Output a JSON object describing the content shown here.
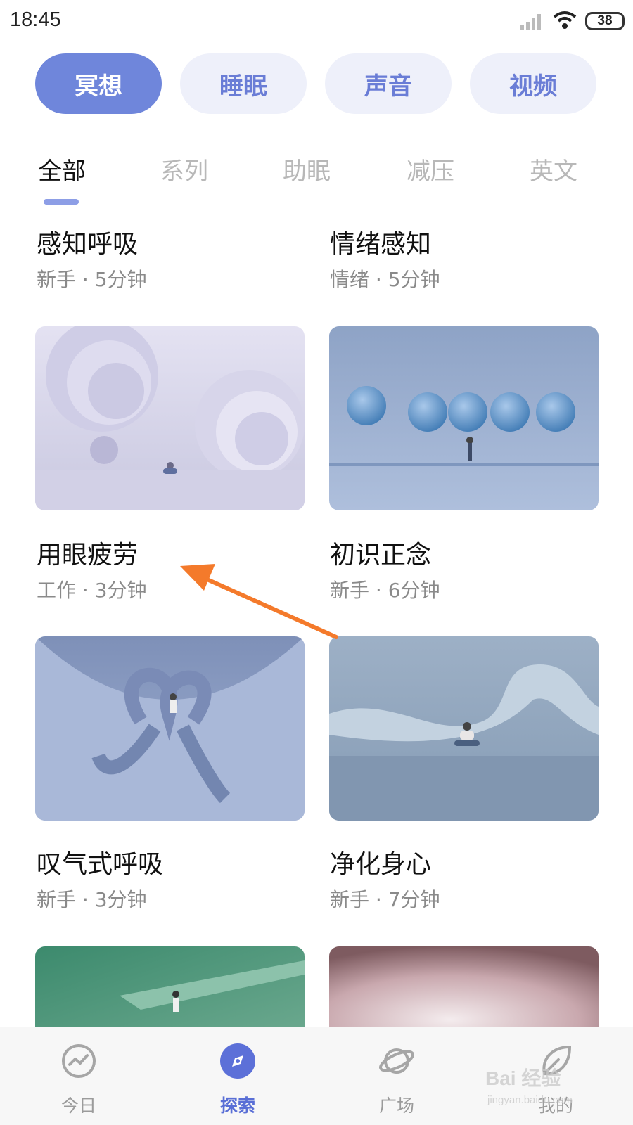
{
  "status_bar": {
    "time": "18:45",
    "battery": "38"
  },
  "categories": [
    {
      "label": "冥想",
      "active": true
    },
    {
      "label": "睡眠",
      "active": false
    },
    {
      "label": "声音",
      "active": false
    },
    {
      "label": "视频",
      "active": false
    }
  ],
  "subtabs": [
    {
      "label": "全部",
      "active": true
    },
    {
      "label": "系列",
      "active": false
    },
    {
      "label": "助眠",
      "active": false
    },
    {
      "label": "减压",
      "active": false
    },
    {
      "label": "英文",
      "active": false
    }
  ],
  "cards": [
    {
      "title": "感知呼吸",
      "meta": "新手 · 5分钟"
    },
    {
      "title": "情绪感知",
      "meta": "情绪 · 5分钟"
    },
    {
      "title": "用眼疲劳",
      "meta": "工作 · 3分钟"
    },
    {
      "title": "初识正念",
      "meta": "新手 · 6分钟"
    },
    {
      "title": "叹气式呼吸",
      "meta": "新手 · 3分钟"
    },
    {
      "title": "净化身心",
      "meta": "新手 · 7分钟"
    }
  ],
  "bottom_nav": [
    {
      "label": "今日",
      "icon": "chart-circle-icon",
      "active": false
    },
    {
      "label": "探索",
      "icon": "compass-icon",
      "active": true
    },
    {
      "label": "广场",
      "icon": "planet-icon",
      "active": false
    },
    {
      "label": "我的",
      "icon": "profile-leaf-icon",
      "active": false
    }
  ],
  "watermark": {
    "text": "Bai 经验",
    "sub": "jingyan.baidu.com"
  },
  "colors": {
    "accent": "#6f86db",
    "pill_bg": "#eef0fa",
    "annotation": "#f47a2b"
  }
}
